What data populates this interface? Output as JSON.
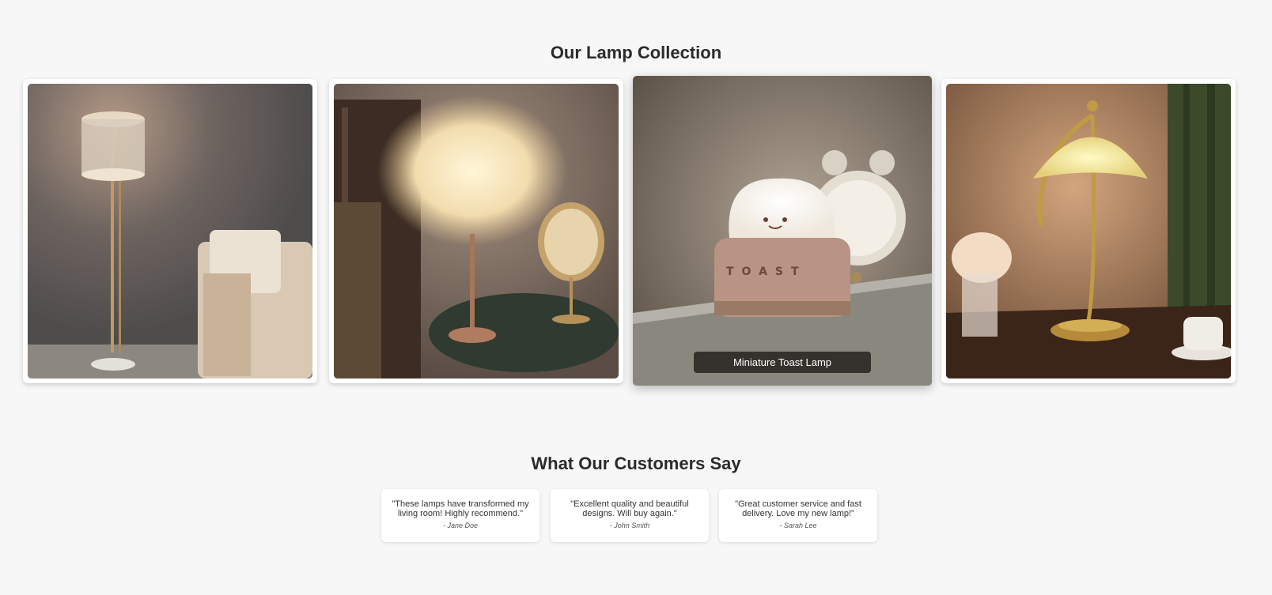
{
  "collection": {
    "title": "Our Lamp Collection",
    "items": [
      {
        "icon": "crystal-floor-lamp-image"
      },
      {
        "icon": "feather-table-lamp-image"
      },
      {
        "icon": "toast-lamp-image",
        "caption": "Miniature Toast Lamp",
        "active": true
      },
      {
        "icon": "umbrella-brass-lamp-image"
      }
    ]
  },
  "testimonials": {
    "title": "What Our Customers Say",
    "items": [
      {
        "quote": "\"These lamps have transformed my living room! Highly recommend.\"",
        "author": "- Jane Doe"
      },
      {
        "quote": "\"Excellent quality and beautiful designs. Will buy again.\"",
        "author": "- John Smith"
      },
      {
        "quote": "\"Great customer service and fast delivery. Love my new lamp!\"",
        "author": "- Sarah Lee"
      }
    ]
  },
  "colors": {
    "background": "#f7f7f7",
    "heading": "#2b2b2b",
    "caption_bg": "#1e1a16"
  }
}
